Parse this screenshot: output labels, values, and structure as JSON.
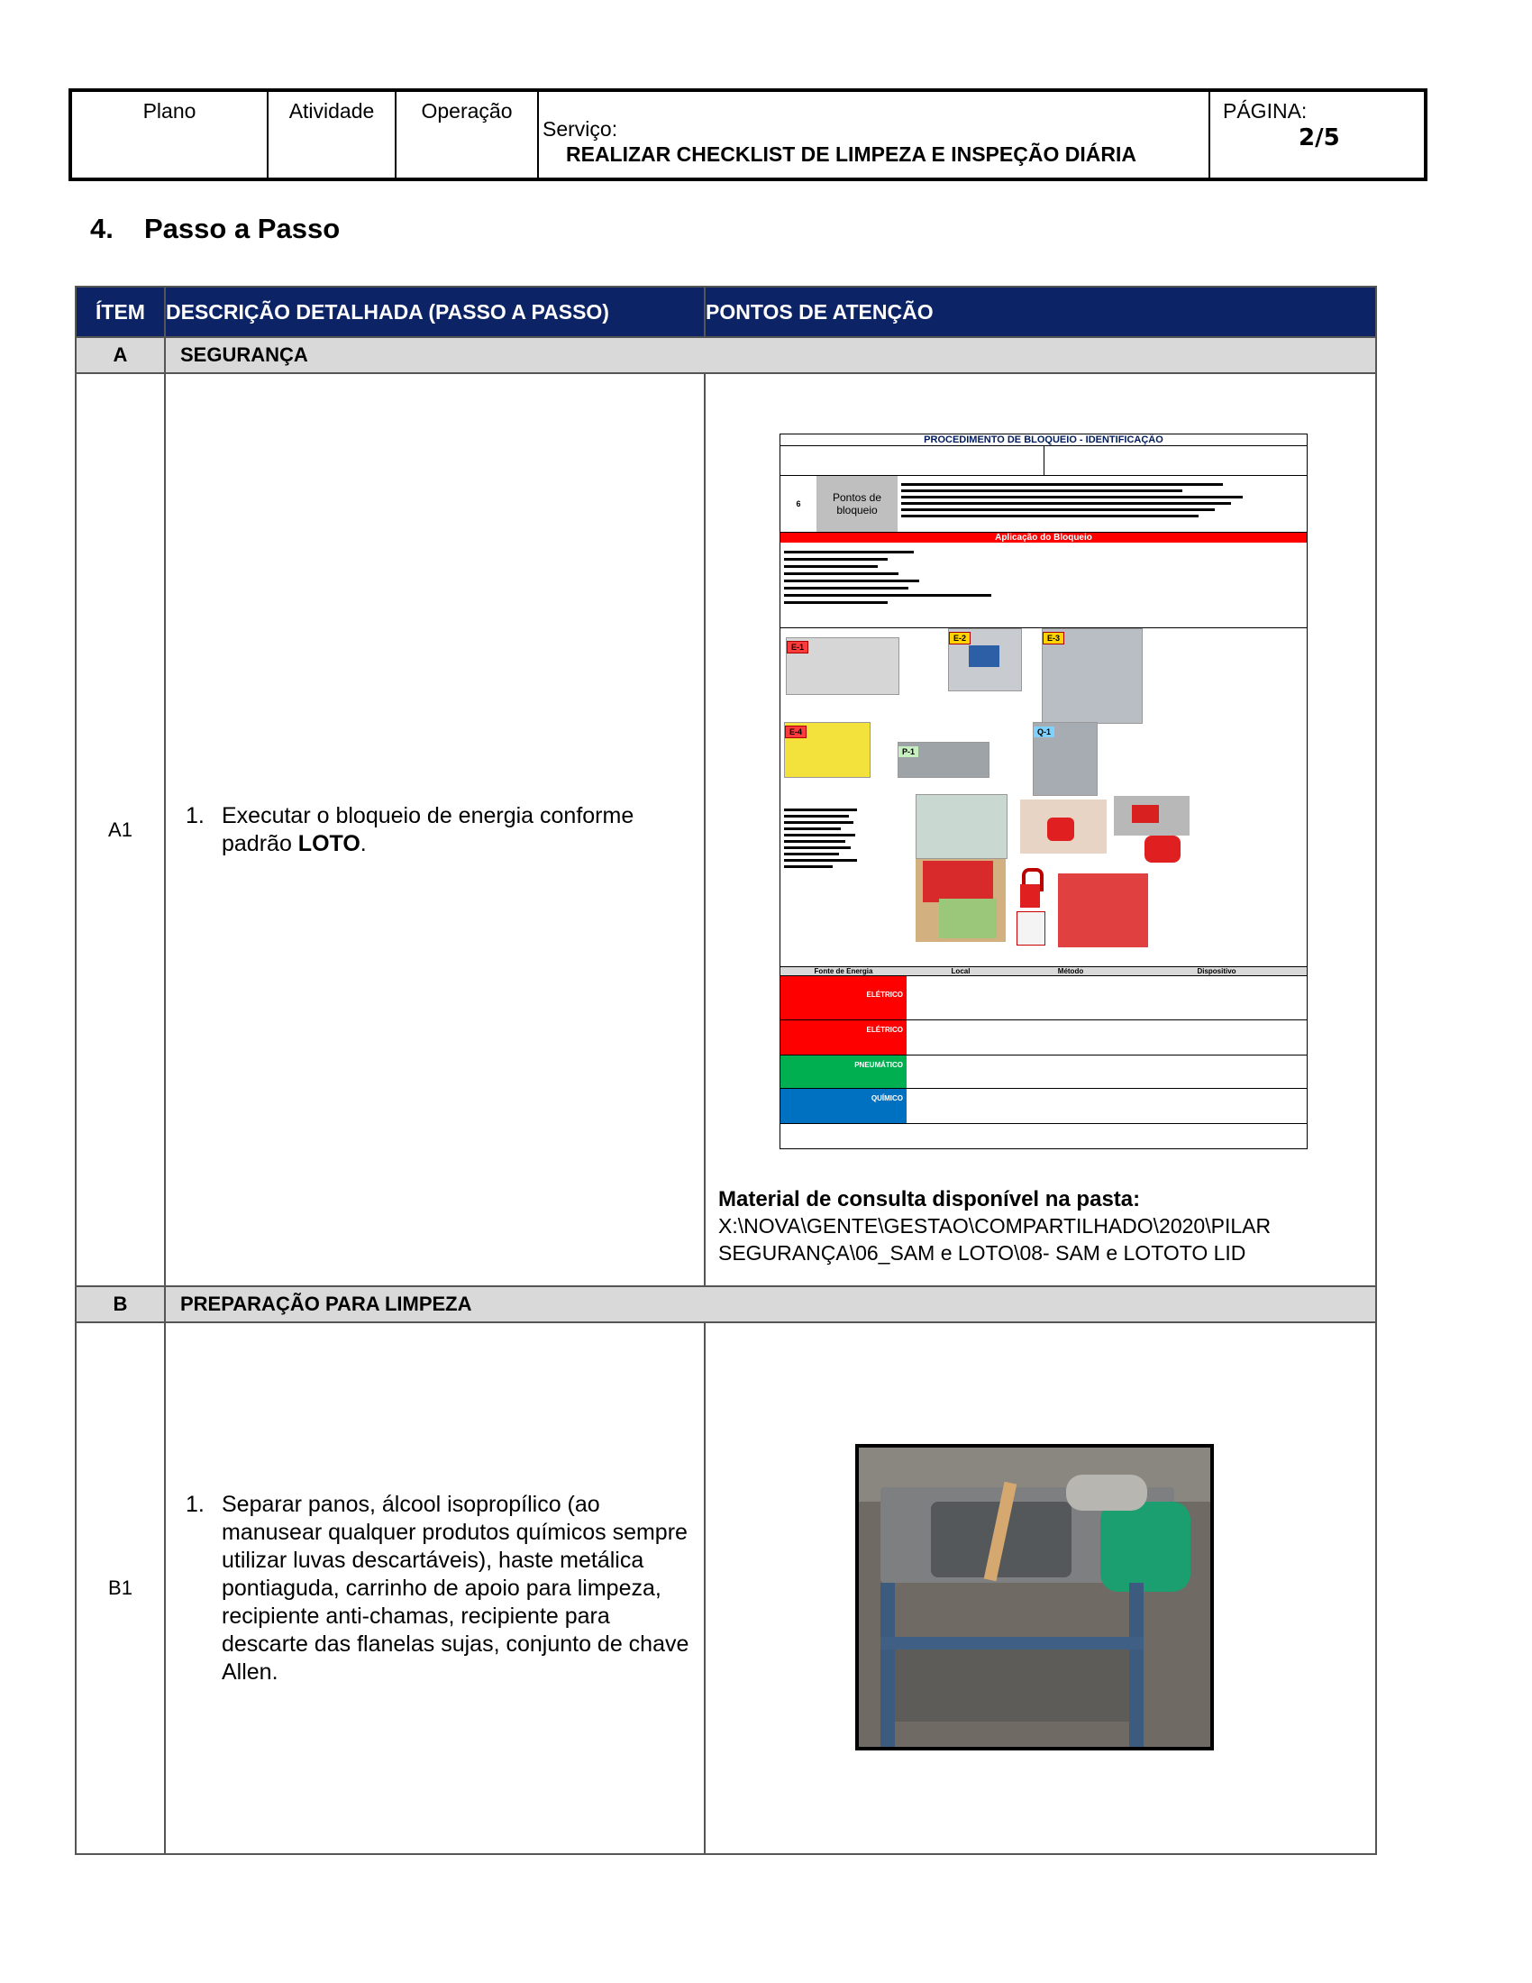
{
  "header": {
    "col1": "Plano",
    "col2": "Atividade",
    "col3": "Operação",
    "service_label": "Serviço:",
    "service_title": "REALIZAR CHECKLIST DE LIMPEZA E INSPEÇÃO DIÁRIA",
    "page_label": "PÁGINA:",
    "page_value": "2/5"
  },
  "section": {
    "number": "4.",
    "title": "Passo a Passo"
  },
  "table": {
    "headers": [
      "ÍTEM",
      "DESCRIÇÃO DETALHADA (PASSO A PASSO)",
      "PONTOS DE ATENÇÃO"
    ],
    "groups": [
      {
        "code": "A",
        "title": "SEGURANÇA"
      },
      {
        "code": "B",
        "title": "PREPARAÇÃO PARA LIMPEZA"
      }
    ],
    "rows": [
      {
        "code": "A1",
        "step_num": "1.",
        "step_text_pre": "Executar o bloqueio de energia conforme padrão ",
        "step_text_bold": "LOTO",
        "step_text_post": ".",
        "reference_label": "Material de consulta disponível na pasta:",
        "reference_path_1": "X:\\NOVA\\GENTE\\GESTAO\\COMPARTILHADO\\2020\\PILAR",
        "reference_path_2": "SEGURANÇA\\06_SAM e LOTO\\08- SAM e LOTOTO LID"
      },
      {
        "code": "B1",
        "step_num": "1.",
        "step_text": "Separar panos, álcool isopropílico (ao manusear qualquer produtos químicos sempre utilizar luvas descartáveis), haste metálica pontiaguda, carrinho de apoio para limpeza, recipiente anti-chamas, recipiente para descarte das flanelas sujas, conjunto de chave Allen."
      }
    ]
  },
  "loto_sheet": {
    "title": "PROCEDIMENTO DE BLOQUEIO - IDENTIFICAÇÃO",
    "points_label": "Pontos de bloqueio",
    "points_count": "6",
    "banner": "Aplicação do Bloqueio",
    "tags": [
      "E-1",
      "E-2",
      "E-3",
      "E-4",
      "P-1",
      "Q-1"
    ],
    "table_headers": [
      "Fonte de Energia",
      "Local",
      "Método",
      "Dispositivo"
    ],
    "sources": [
      "ELÉTRICO",
      "ELÉTRICO",
      "PNEUMÁTICO",
      "QUÍMICO"
    ]
  },
  "colors": {
    "header_blue": "#0c2366",
    "group_gray": "#d9d9d9",
    "loto_red": "#ff0000"
  }
}
